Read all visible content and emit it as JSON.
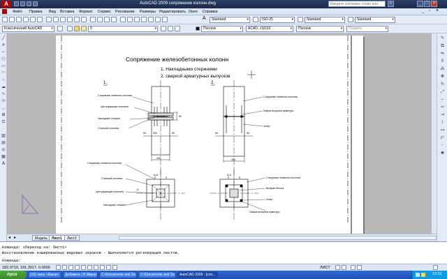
{
  "window": {
    "title": "AutoCAD 2009  сопряжение колонн.dwg",
    "search_placeholder": "Введите ключевое слово или фразу"
  },
  "menu": [
    "Файл",
    "Правка",
    "Вид",
    "Вставка",
    "Формат",
    "Сервис",
    "Рисование",
    "Размеры",
    "Редактировать",
    "Окно",
    "Справка"
  ],
  "toolbar2": {
    "textstyle": "Standard",
    "dimstyle": "ISO-25",
    "tablestyle": "Standard",
    "mleaderstyle": "Standard"
  },
  "toolbar3": {
    "workspace": "Классический AutoCAD",
    "layer": "0",
    "color": "Послою",
    "linetype": "ACAD...ISO10",
    "lineweight": "Послою",
    "plotstyle": "Поцвету"
  },
  "drawing": {
    "title": "Сопряжение железобетонных колонн",
    "list": [
      "1. Накладными стержнями",
      "2. сваркой арматурных выпусков"
    ],
    "section1": "1.",
    "section2": "2.",
    "left_labels": {
      "a": "Стыкуемые элементы колонны",
      "b": "Центрирующая пластина",
      "c": "Накладные стержни",
      "d": "Стальной оголовок"
    },
    "right_labels": {
      "a": "Стыкуемые элементы колонны",
      "b": "Сварка выпусков арматуры",
      "c": "Хомут"
    },
    "plan_left_labels": {
      "a": "Стыкуемые элементы колонны",
      "b": "Стальной оголовок",
      "c": "Центрирующая пластина",
      "d": "Накладные стержни"
    },
    "plan_right_labels": {
      "a": "Стыкуемые элементы колонны",
      "b": "Выпуски бетона",
      "c": "Хомут",
      "d": "Сварка выпусков арматуры"
    },
    "dims": {
      "d50": "50",
      "d400": "400",
      "d300": "300",
      "d60": "60",
      "d30": "30",
      "aa": "А-А",
      "a": "А"
    }
  },
  "tabs": [
    "Модель",
    "Лист1",
    "Лист2"
  ],
  "active_tab": "Лист1",
  "command_lines": [
    "Команда:  <Переход на: Лист1>",
    "Восстановление кэшированных видовых экранов - Выполняется регенерация листов.",
    "Команда:"
  ],
  "status": {
    "coords": "182.9710, 191.3017, 0.0000",
    "layout": "ЛИСТ"
  },
  "taskbar": {
    "start": "пуск",
    "tasks": [
      "(19) чаты «Ваши»",
      "Добавить | В Мишу»...",
      "C:\\Documents and Se...",
      "C:\\Documents and Se...",
      "AutoCAD 2009 - [con..."
    ],
    "clock": "12:31"
  },
  "colors": {
    "titlebar": "#1c2b4a",
    "workspace": "#b8b8b8",
    "taskbar": "#1f4fb4",
    "start": "#3a8a2b"
  }
}
